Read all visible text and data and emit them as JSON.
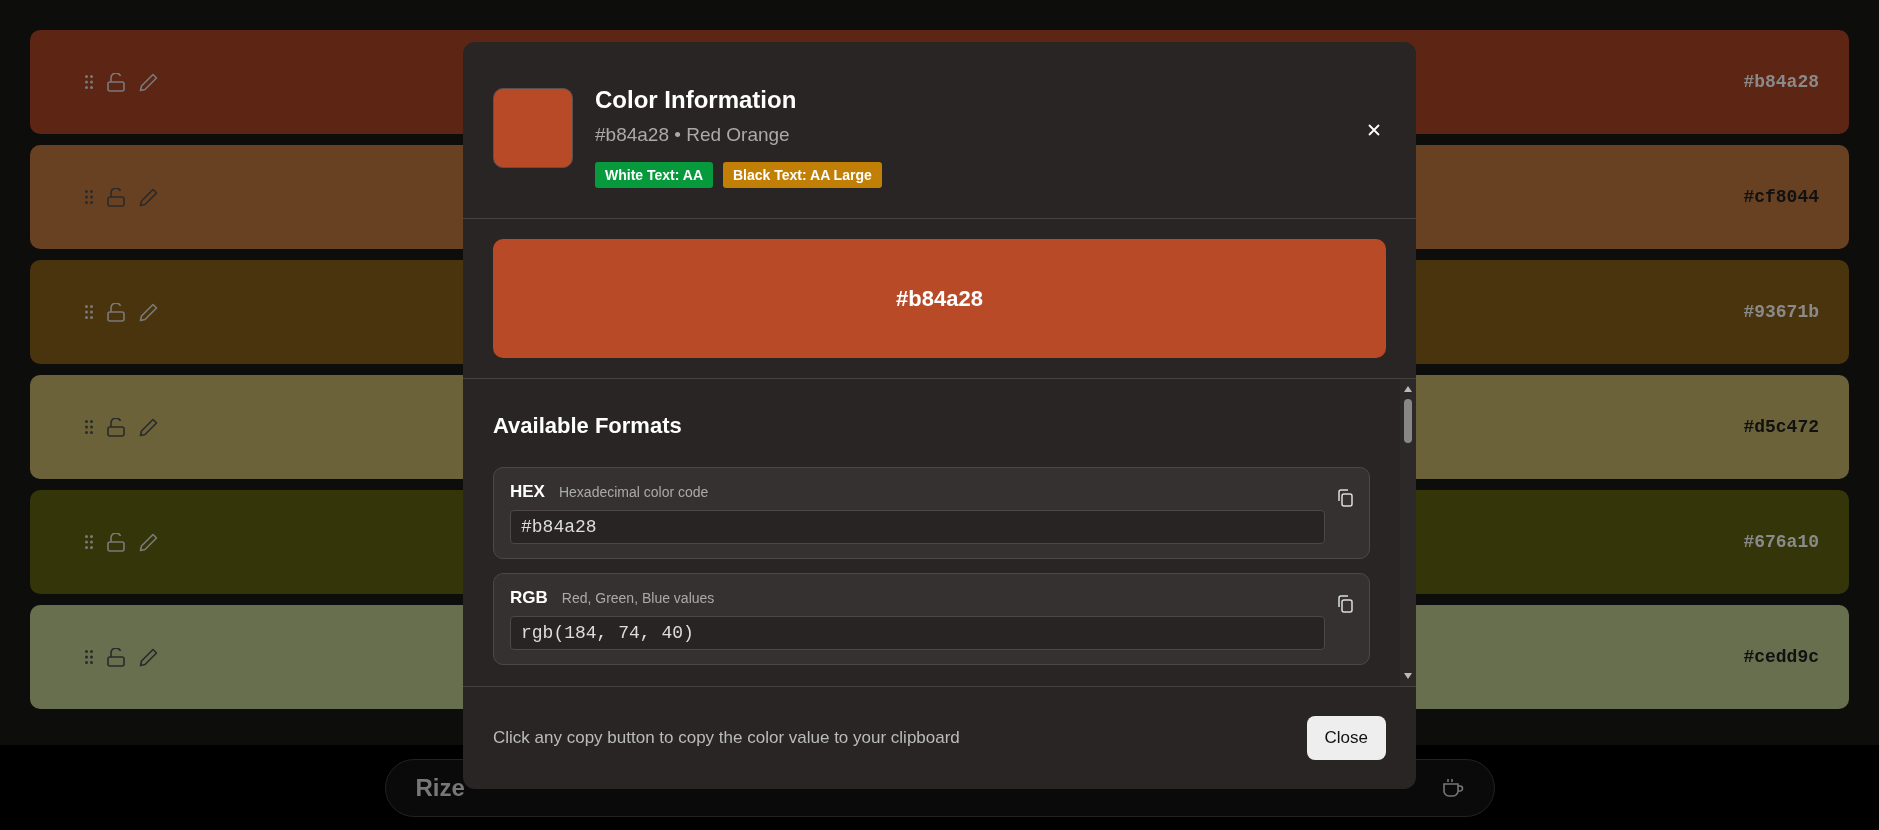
{
  "palette": [
    {
      "hex": "#b84a28",
      "color": "#5c2514"
    },
    {
      "hex": "#cf8044",
      "color": "#684022"
    },
    {
      "hex": "#93671b",
      "color": "#4a340e"
    },
    {
      "hex": "#d5c472",
      "color": "#6b6239"
    },
    {
      "hex": "#676a10",
      "color": "#343508"
    },
    {
      "hex": "#cedd9c",
      "color": "#676f4e"
    }
  ],
  "bottom_bar": {
    "brand": "Rize"
  },
  "modal": {
    "title": "Color Information",
    "subtitle": "#b84a28 • Red Orange",
    "swatch": {
      "color": "#b84a28"
    },
    "badges": [
      {
        "label": "White Text: AA",
        "color": "#079a3c"
      },
      {
        "label": "Black Text: AA Large",
        "color": "#c27f05"
      }
    ],
    "preview": {
      "label": "#b84a28",
      "color": "#b84a28"
    },
    "section_title": "Available Formats",
    "formats": [
      {
        "name": "HEX",
        "description": "Hexadecimal color code",
        "value": "#b84a28"
      },
      {
        "name": "RGB",
        "description": "Red, Green, Blue values",
        "value": "rgb(184, 74, 40)"
      }
    ],
    "footer_text": "Click any copy button to copy the color value to your clipboard",
    "close_label": "Close"
  }
}
